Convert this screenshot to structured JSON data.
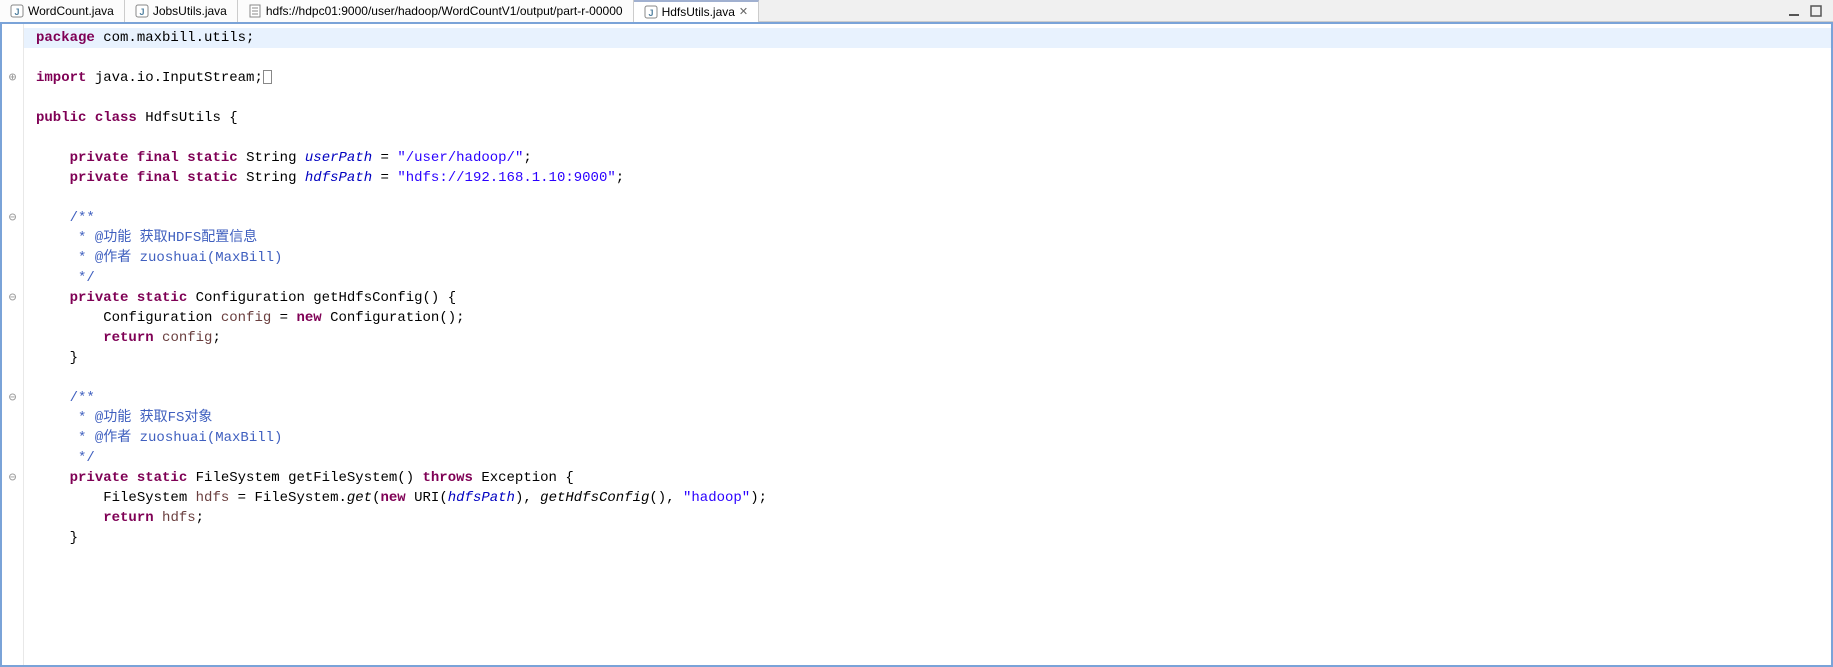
{
  "tabs": [
    {
      "label": "WordCount.java",
      "icon": "java-icon",
      "active": false
    },
    {
      "label": "JobsUtils.java",
      "icon": "java-icon",
      "active": false
    },
    {
      "label": "hdfs://hdpc01:9000/user/hadoop/WordCountV1/output/part-r-00000",
      "icon": "file-icon",
      "active": false
    },
    {
      "label": "HdfsUtils.java",
      "icon": "java-icon",
      "active": true
    }
  ],
  "code": {
    "package_kw": "package",
    "package_name": " com.maxbill.utils;",
    "import_kw": "import",
    "import_name": " java.io.InputStream;",
    "public_kw": "public",
    "class_kw": "class",
    "class_name": " HdfsUtils {",
    "private_kw": "private",
    "final_kw": "final",
    "static_kw": "static",
    "string_type": " String ",
    "userPath_name": "userPath",
    "userPath_eq": " = ",
    "userPath_val": "\"/user/hadoop/\"",
    "semi": ";",
    "hdfsPath_name": "hdfsPath",
    "hdfsPath_val": "\"hdfs://192.168.1.10:9000\"",
    "doc_open": "/**",
    "doc_l1a": " * @功能 获取HDFS配置信息",
    "doc_l2": " * @作者 zuoshuai(MaxBill)",
    "doc_close": " */",
    "cfg_type": " Configuration ",
    "cfg_method": "getHdfsConfig() {",
    "cfg_body1_a": "Configuration ",
    "cfg_body1_var": "config",
    "cfg_body1_b": " = ",
    "new_kw": "new",
    "cfg_body1_c": " Configuration();",
    "return_kw": "return",
    "cfg_body2_b": " config",
    "close_brace": "}",
    "doc_l1b": " * @功能 获取FS对象",
    "fs_type": " FileSystem ",
    "fs_method": "getFileSystem() ",
    "throws_kw": "throws",
    "fs_method2": " Exception {",
    "fs_body1_a": "FileSystem ",
    "fs_body1_var": "hdfs",
    "fs_body1_b": " = FileSystem.",
    "fs_get": "get",
    "fs_body1_c": "(",
    "fs_body1_d": " URI(",
    "fs_body1_ref": "hdfsPath",
    "fs_body1_e": "), ",
    "fs_body1_call": "getHdfsConfig",
    "fs_body1_f": "(), ",
    "fs_body1_str": "\"hadoop\"",
    "fs_body1_g": ");",
    "fs_body2_b": " hdfs"
  },
  "gutter_plus": "⊕",
  "gutter_minus": "⊖"
}
